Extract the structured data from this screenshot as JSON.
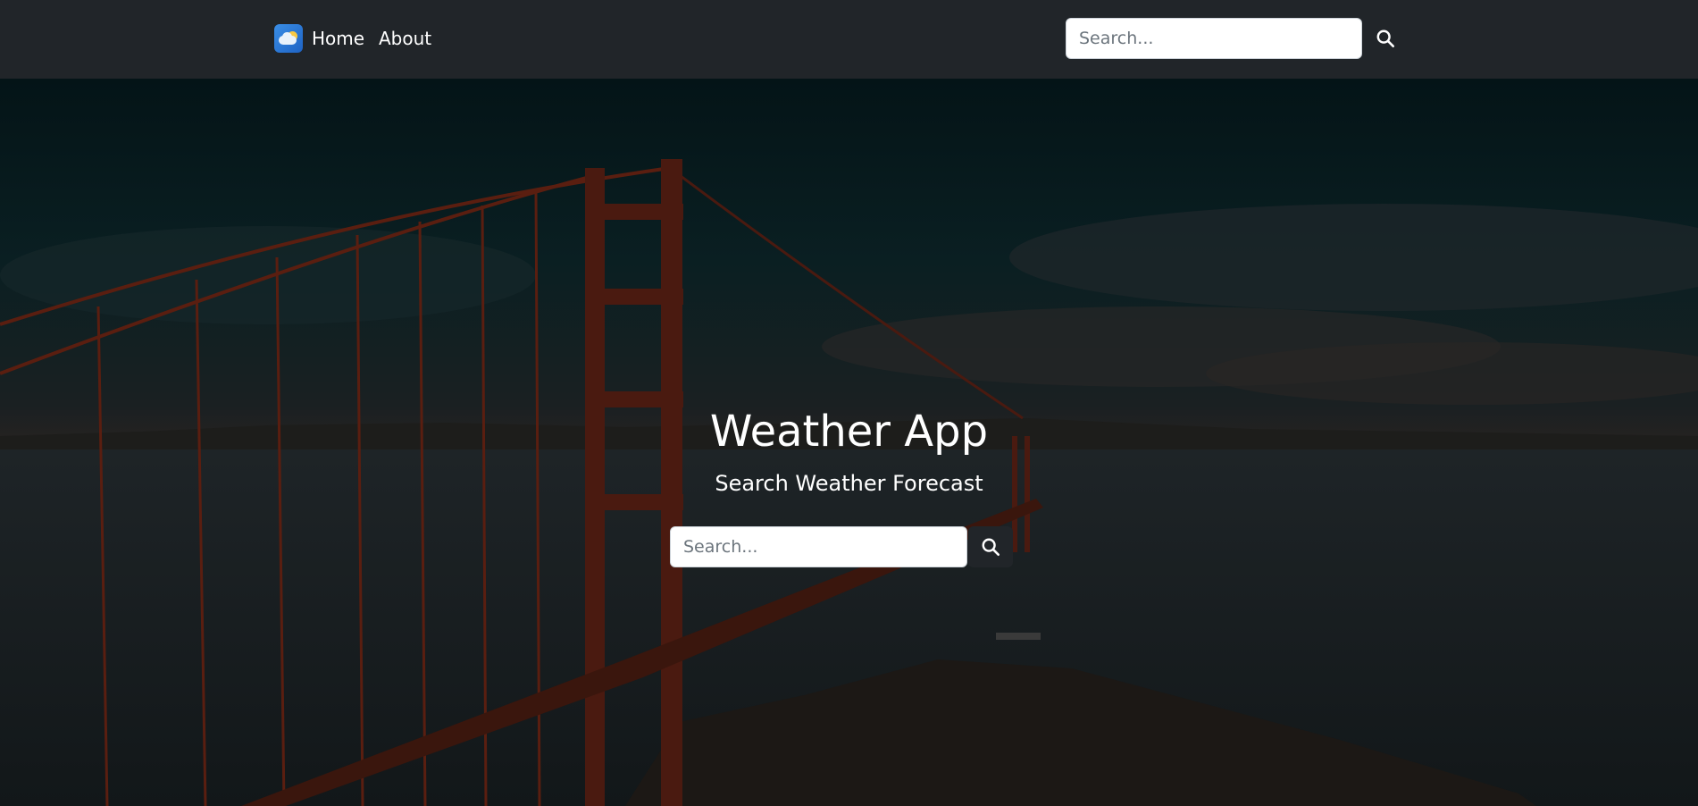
{
  "navbar": {
    "brand_icon": "weather-cloud-sun-icon",
    "links": [
      {
        "label": "Home"
      },
      {
        "label": "About"
      }
    ],
    "search": {
      "placeholder": "Search...",
      "value": "",
      "button_icon": "search-icon"
    }
  },
  "hero": {
    "background": "golden-gate-bridge-sunset-photo",
    "title": "Weather App",
    "subtitle": "Search Weather Forecast",
    "search": {
      "placeholder": "Search...",
      "value": "",
      "button_icon": "search-icon"
    }
  },
  "colors": {
    "navbar_bg": "#212529",
    "button_dark": "#212529",
    "text_light": "#ffffff",
    "bridge": "#8a2a14"
  }
}
